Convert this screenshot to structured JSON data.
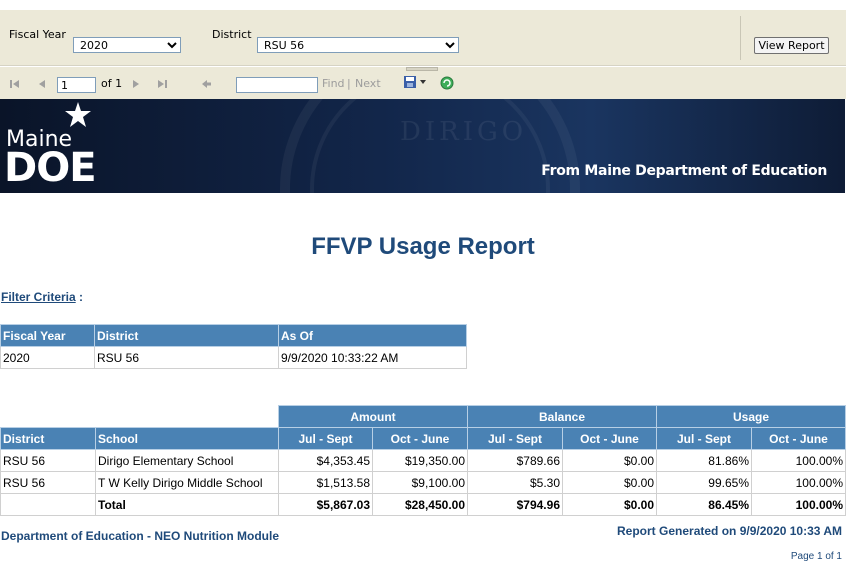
{
  "params": {
    "fiscal_year_label": "Fiscal Year",
    "fiscal_year_value": "2020",
    "district_label": "District",
    "district_value": "RSU 56",
    "view_report_label": "View Report"
  },
  "toolbar": {
    "page_input": "1",
    "of_pages": "of 1",
    "find_label": "Find",
    "separator": "|",
    "next_label": "Next",
    "icons": [
      "first-page-icon",
      "prev-page-icon",
      "next-page-icon",
      "last-page-icon",
      "back-icon",
      "export-icon",
      "refresh-icon"
    ]
  },
  "banner": {
    "logo_maine": "Maine",
    "logo_doe": "DOE",
    "motto": "DIRIGO",
    "tagline": "From Maine Department of Education"
  },
  "report": {
    "title": "FFVP Usage Report",
    "filter_label": "Filter Criteria",
    "filter_colon": ":",
    "criteria_headers": [
      "Fiscal Year",
      "District",
      "As Of"
    ],
    "criteria_row": [
      "2020",
      "RSU 56",
      "9/9/2020 10:33:22 AM"
    ],
    "group_headers": [
      "Amount",
      "Balance",
      "Usage"
    ],
    "col_headers": [
      "District",
      "School",
      "Jul - Sept",
      "Oct - June",
      "Jul - Sept",
      "Oct - June",
      "Jul - Sept",
      "Oct - June"
    ],
    "rows": [
      [
        "RSU 56",
        "Dirigo Elementary School",
        "$4,353.45",
        "$19,350.00",
        "$789.66",
        "$0.00",
        "81.86%",
        "100.00%"
      ],
      [
        "RSU 56",
        "T W Kelly Dirigo Middle School",
        "$1,513.58",
        "$9,100.00",
        "$5.30",
        "$0.00",
        "99.65%",
        "100.00%"
      ]
    ],
    "total": [
      "",
      "Total",
      "$5,867.03",
      "$28,450.00",
      "$794.96",
      "$0.00",
      "86.45%",
      "100.00%"
    ],
    "footer_left": "Department of Education - NEO Nutrition Module",
    "footer_right": "Report Generated on 9/9/2020 10:33 AM",
    "page_info": "Page 1 of 1"
  },
  "colors": {
    "header_blue": "#4a82b4",
    "title_blue": "#1f4a7a",
    "toolbar_bg": "#ece9d8"
  }
}
